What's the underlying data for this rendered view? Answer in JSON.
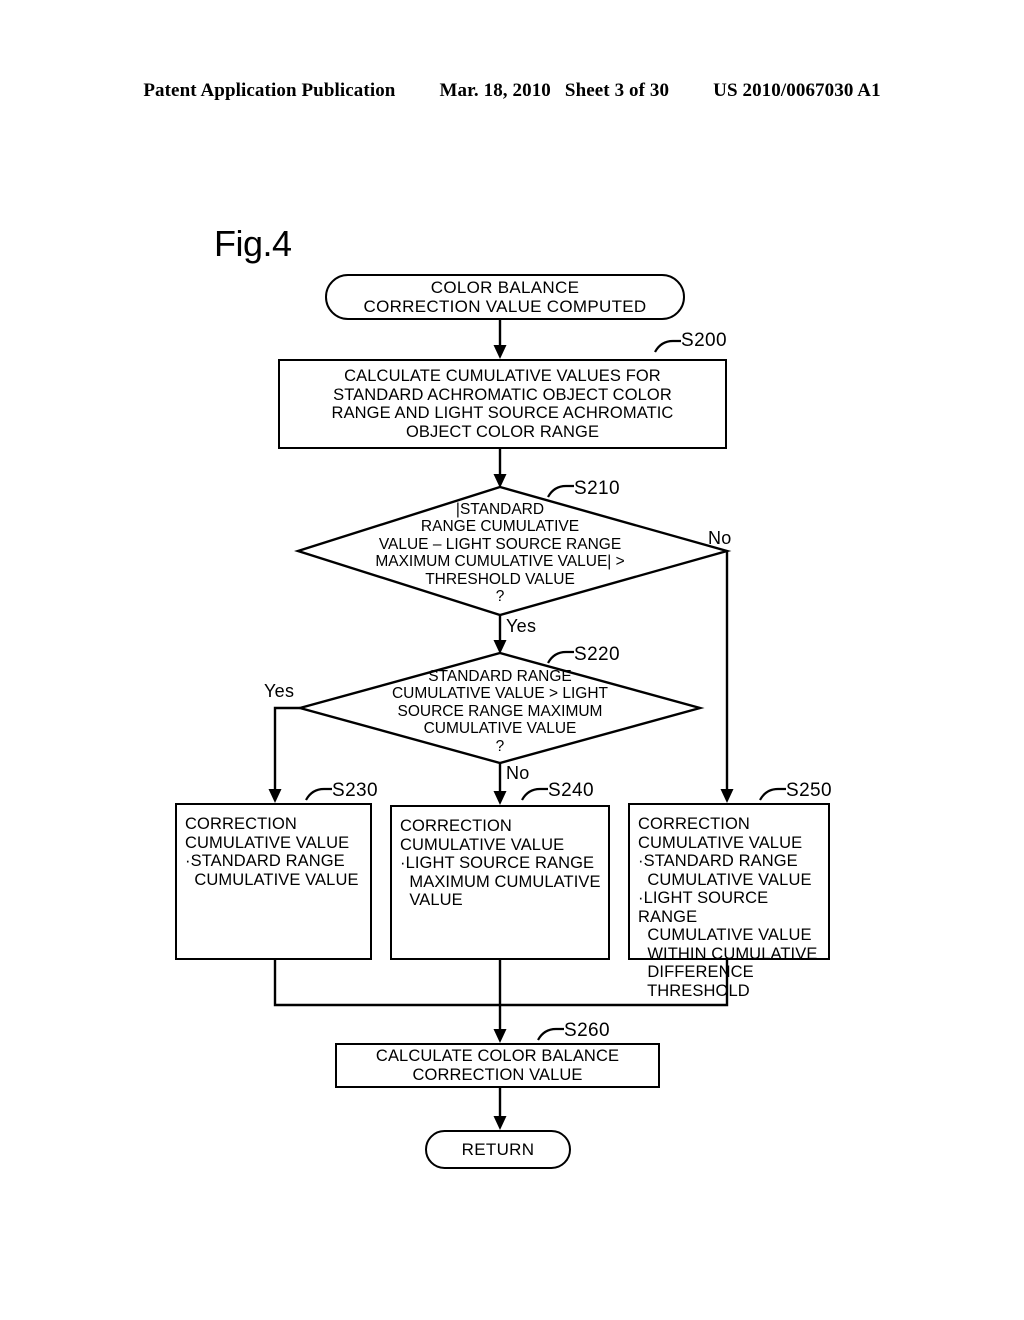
{
  "header": {
    "publication": "Patent Application Publication",
    "date": "Mar. 18, 2010",
    "sheet": "Sheet 3 of 30",
    "patent_number": "US 2010/0067030 A1"
  },
  "figure": {
    "label": "Fig.4",
    "start": {
      "step": "",
      "lines": [
        "COLOR BALANCE",
        "CORRECTION VALUE COMPUTED"
      ]
    },
    "s200": {
      "step": "S200",
      "lines": [
        "CALCULATE CUMULATIVE VALUES FOR",
        "STANDARD ACHROMATIC OBJECT COLOR",
        "RANGE AND LIGHT SOURCE ACHROMATIC",
        "OBJECT COLOR RANGE"
      ]
    },
    "s210": {
      "step": "S210",
      "lines": [
        "|STANDARD",
        "RANGE CUMULATIVE",
        "VALUE – LIGHT SOURCE RANGE",
        "MAXIMUM CUMULATIVE VALUE| >",
        "THRESHOLD VALUE",
        "?"
      ],
      "yes_label": "Yes",
      "no_label": "No"
    },
    "s220": {
      "step": "S220",
      "lines": [
        "STANDARD RANGE",
        "CUMULATIVE VALUE > LIGHT",
        "SOURCE RANGE MAXIMUM",
        "CUMULATIVE VALUE",
        "?"
      ],
      "yes_label": "Yes",
      "no_label": "No"
    },
    "s230": {
      "step": "S230",
      "lines": [
        "CORRECTION",
        "CUMULATIVE VALUE",
        "·STANDARD RANGE",
        "  CUMULATIVE VALUE"
      ]
    },
    "s240": {
      "step": "S240",
      "lines": [
        "CORRECTION",
        "CUMULATIVE VALUE",
        "·LIGHT SOURCE RANGE",
        "  MAXIMUM CUMULATIVE",
        "  VALUE"
      ]
    },
    "s250": {
      "step": "S250",
      "lines": [
        "CORRECTION",
        "CUMULATIVE VALUE",
        "·STANDARD RANGE",
        "  CUMULATIVE VALUE",
        "·LIGHT SOURCE RANGE",
        "  CUMULATIVE VALUE",
        "  WITHIN CUMULATIVE",
        "  DIFFERENCE",
        "  THRESHOLD"
      ]
    },
    "s260": {
      "step": "S260",
      "lines": [
        "CALCULATE COLOR BALANCE",
        "CORRECTION VALUE"
      ]
    },
    "end": {
      "step": "",
      "lines": [
        "RETURN"
      ]
    }
  },
  "colors": {
    "ink": "#000000",
    "paper": "#ffffff"
  }
}
